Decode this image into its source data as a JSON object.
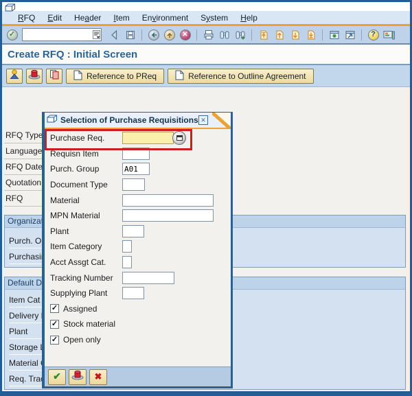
{
  "menubar": {
    "items": [
      {
        "label": "RFQ",
        "mnemonic": 0
      },
      {
        "label": "Edit",
        "mnemonic": 0
      },
      {
        "label": "Header",
        "mnemonic": 2
      },
      {
        "label": "Item",
        "mnemonic": 0
      },
      {
        "label": "Environment",
        "mnemonic": 2
      },
      {
        "label": "System",
        "mnemonic": 1
      },
      {
        "label": "Help",
        "mnemonic": 0
      }
    ]
  },
  "toolbar": {
    "command_value": "",
    "icons": [
      "back-arrow-icon",
      "save-icon",
      "sep",
      "nav-back-icon",
      "nav-exit-icon",
      "nav-cancel-icon",
      "sep",
      "print-icon",
      "find-icon",
      "find-next-icon",
      "sep",
      "first-page-icon",
      "prev-page-icon",
      "next-page-icon",
      "last-page-icon",
      "sep",
      "new-session-icon",
      "shortcut-icon",
      "sep",
      "help-icon",
      "customize-icon"
    ]
  },
  "page": {
    "title": "Create RFQ : Initial Screen"
  },
  "app_toolbar": {
    "icon_buttons": [
      {
        "icon": "person-icon"
      },
      {
        "icon": "hat-icon"
      },
      {
        "icon": "copy-icon"
      }
    ],
    "buttons": [
      {
        "icon": "document-icon",
        "label": "Reference to PReq"
      },
      {
        "icon": "document-icon",
        "label": "Reference to Outline Agreement"
      }
    ]
  },
  "background_form": {
    "top_fields": [
      "RFQ Type",
      "Language",
      "RFQ Date",
      "Quotation",
      "RFQ"
    ],
    "groups": [
      {
        "header": "Organizat",
        "rows": [
          "Purch. O",
          "Purchasin"
        ]
      },
      {
        "header": "Default D",
        "rows": [
          "Item Cat",
          "Delivery D",
          "Plant",
          "Storage L",
          "Material G",
          "Req. Trac"
        ]
      }
    ]
  },
  "dialog": {
    "title": "Selection of Purchase Requisitions",
    "rows": [
      {
        "type": "field",
        "label": "Purchase Req.",
        "value": "",
        "size": "md",
        "required": true,
        "f4": true,
        "highlighted": true
      },
      {
        "type": "field",
        "label": "Requisn Item",
        "value": "",
        "size": "sm"
      },
      {
        "type": "field",
        "label": "Purch. Group",
        "value": "A01",
        "size": "sm"
      },
      {
        "type": "field",
        "label": "Document Type",
        "value": "",
        "size": "s"
      },
      {
        "type": "field",
        "label": "Material",
        "value": "",
        "size": "xl"
      },
      {
        "type": "field",
        "label": "MPN Material",
        "value": "",
        "size": "xl"
      },
      {
        "type": "field",
        "label": "Plant",
        "value": "",
        "size": "xs"
      },
      {
        "type": "field",
        "label": "Item Category",
        "value": "",
        "size": "xxs"
      },
      {
        "type": "field",
        "label": "Acct Assgt Cat.",
        "value": "",
        "size": "xxs"
      },
      {
        "type": "field",
        "label": "Tracking Number",
        "value": "",
        "size": "lg"
      },
      {
        "type": "field",
        "label": "Supplying Plant",
        "value": "",
        "size": "xs"
      },
      {
        "type": "checkbox",
        "label": "Assigned",
        "checked": true
      },
      {
        "type": "checkbox",
        "label": "Stock material",
        "checked": true
      },
      {
        "type": "checkbox",
        "label": "Open only",
        "checked": true
      }
    ],
    "footer_buttons": [
      {
        "icon": "check-icon"
      },
      {
        "icon": "hat-icon"
      },
      {
        "icon": "cancel-x-icon"
      }
    ]
  },
  "colors": {
    "window_border": "#215e99",
    "accent_orange": "#e9a233",
    "highlight_red": "#cf1d1d",
    "required_field_yellow": "#fbf0ab",
    "group_fill_blue": "#d3e1f0",
    "toolbar_blue": "#bed3e9"
  }
}
